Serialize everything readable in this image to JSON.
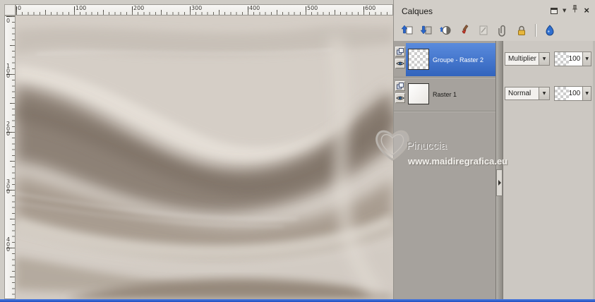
{
  "colors": {
    "selection_blue": "#3d74cf",
    "taskbar_blue": "#2b5cd9",
    "panel_bg": "#d2cec8",
    "rows_bg": "#a6a29d"
  },
  "rulers": {
    "horizontal": [
      "0",
      "100",
      "200",
      "300",
      "400",
      "500",
      "600"
    ],
    "vertical": [
      "0",
      "100",
      "200",
      "300",
      "400"
    ]
  },
  "layers_panel": {
    "title": "Calques",
    "window_controls": [
      "restore-icon",
      "menu-arrow-icon",
      "pin-icon",
      "close-icon"
    ],
    "toolbar_icons": [
      "new-raster-layer-icon",
      "new-mask-layer-icon",
      "new-adjustment-layer-icon",
      "new-art-media-layer-icon",
      "new-vector-layer-icon",
      "link-layers-icon",
      "lock-transparency-icon",
      "edit-selection-icon"
    ],
    "layers": [
      {
        "name": "Groupe - Raster 2",
        "blend_mode": "Multiplier",
        "opacity": "100",
        "selected": true
      },
      {
        "name": "Raster 1",
        "blend_mode": "Normal",
        "opacity": "100",
        "selected": false
      }
    ]
  },
  "watermark": {
    "name": "Pinuccia",
    "site": "www.maidiregrafica.eu"
  }
}
